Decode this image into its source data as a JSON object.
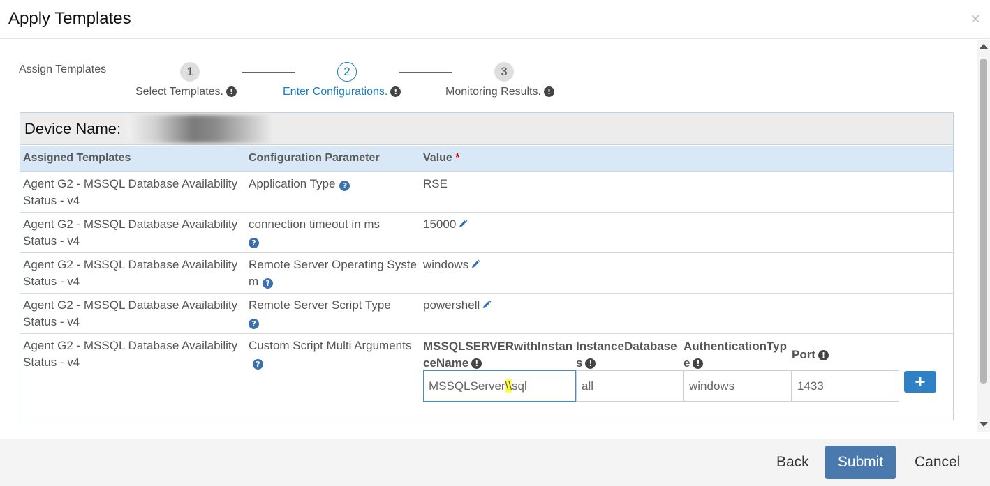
{
  "dialog": {
    "title": "Apply Templates",
    "close_label": "×"
  },
  "wizard": {
    "assign_label": "Assign Templates",
    "steps": [
      {
        "number": "1",
        "label": "Select Templates.",
        "active": false
      },
      {
        "number": "2",
        "label": "Enter Configurations.",
        "active": true
      },
      {
        "number": "3",
        "label": "Monitoring Results.",
        "active": false
      }
    ],
    "info_glyph": "!"
  },
  "device": {
    "label": "Device Name:"
  },
  "table": {
    "headers": {
      "assigned": "Assigned Templates",
      "param": "Configuration Parameter",
      "value": "Value",
      "required": "*"
    },
    "rows": [
      {
        "template": "Agent G2 - MSSQL Database Availability Status - v4",
        "param": "Application Type",
        "value": "RSE",
        "editable": false
      },
      {
        "template": "Agent G2 - MSSQL Database Availability Status - v4",
        "param": "connection timeout in ms",
        "value": "15000",
        "editable": true
      },
      {
        "template": "Agent G2 - MSSQL Database Availability Status - v4",
        "param": "Remote Server Operating System",
        "value": "windows",
        "editable": true
      },
      {
        "template": "Agent G2 - MSSQL Database Availability Status - v4",
        "param": "Remote Server Script Type",
        "value": "powershell",
        "editable": true
      },
      {
        "template": "Agent G2 - MSSQL Database Availability Status - v4",
        "param": "Custom Script Multi Arguments"
      }
    ],
    "multi_args": {
      "columns": [
        "MSSQLSERVERwithInstanceName",
        "InstanceDatabases",
        "AuthenticationType",
        "Port"
      ],
      "values": {
        "instance_before": "MSSQLServer",
        "instance_highlight": "\\\\",
        "instance_after": "sql",
        "databases": "all",
        "auth": "windows",
        "port": "1433"
      },
      "add_label": "+"
    },
    "help_glyph": "?"
  },
  "footer": {
    "back": "Back",
    "submit": "Submit",
    "cancel": "Cancel"
  },
  "colors": {
    "accent": "#1a7fc1",
    "submit": "#4a7aad",
    "add": "#2f80c4",
    "header_row": "#d9e8f7",
    "highlight": "#ffff3b"
  }
}
